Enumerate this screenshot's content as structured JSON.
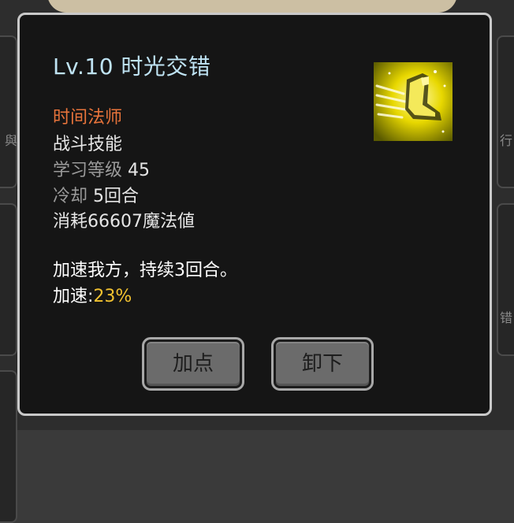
{
  "skill": {
    "title": "Lv.10 时光交错",
    "school": "时间法师",
    "type": "战斗技能",
    "learn_level_label": "学习等级",
    "learn_level_value": "45",
    "cooldown_label": "冷却",
    "cooldown_value": "5回合",
    "cost": "消耗66607魔法値",
    "description": "加速我方，持续3回合。",
    "effect_label": "加速:",
    "effect_value": "23%",
    "icon": "golden-boot-speed-icon"
  },
  "buttons": {
    "add_label": "加点",
    "remove_label": "卸下"
  },
  "background": {
    "left_tab_char": "與",
    "right_tab_char_1": "行",
    "right_tab_char_2": "错"
  },
  "colors": {
    "title": "#bfe3f3",
    "school": "#e8743b",
    "effect_value": "#f2c230",
    "panel_bg": "#151515",
    "panel_border": "#c9c9c9"
  }
}
